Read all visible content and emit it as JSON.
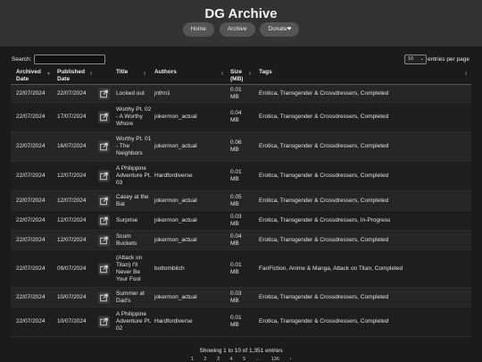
{
  "header": {
    "title": "DG Archive",
    "nav": [
      "Home",
      "Archive",
      "Donate"
    ]
  },
  "controls": {
    "search_label": "Search:",
    "search_value": "",
    "page_length": "10",
    "page_length_label": "entries per page"
  },
  "table": {
    "columns": [
      "Archived Date",
      "Published Date",
      "",
      "Title",
      "Authors",
      "Size (MB)",
      "Tags"
    ],
    "rows": [
      {
        "archived": "22/07/2024",
        "published": "22/07/2024",
        "title": "Locked out",
        "author": "jnthn1",
        "size": "0.01 MB",
        "tags": "Erotica, Transgender & Crossdressers, Completed"
      },
      {
        "archived": "22/07/2024",
        "published": "17/07/2024",
        "title": "Worthy Pt. 02 - A Worthy Whore",
        "author": "jokermon_actual",
        "size": "0.04 MB",
        "tags": "Erotica, Transgender & Crossdressers, Completed"
      },
      {
        "archived": "22/07/2024",
        "published": "16/07/2024",
        "title": "Worthy Pt. 01 - The Neighbors",
        "author": "jokermon_actual",
        "size": "0.06 MB",
        "tags": "Erotica, Transgender & Crossdressers, Completed"
      },
      {
        "archived": "22/07/2024",
        "published": "12/07/2024",
        "title": "A Philippine Adventure Pt. 03",
        "author": "Hardfordiverse",
        "size": "0.01 MB",
        "tags": "Erotica, Transgender & Crossdressers, Completed"
      },
      {
        "archived": "22/07/2024",
        "published": "12/07/2024",
        "title": "Casey at the Bat",
        "author": "jokermon_actual",
        "size": "0.05 MB",
        "tags": "Erotica, Transgender & Crossdressers, Completed"
      },
      {
        "archived": "22/07/2024",
        "published": "12/07/2024",
        "title": "Surprise",
        "author": "jokermon_actual",
        "size": "0.03 MB",
        "tags": "Erotica, Transgender & Crossdressers, In-Progress"
      },
      {
        "archived": "22/07/2024",
        "published": "12/07/2024",
        "title": "Scum Buckets",
        "author": "jokermon_actual",
        "size": "0.04 MB",
        "tags": "Erotica, Transgender & Crossdressers, Completed"
      },
      {
        "archived": "22/07/2024",
        "published": "09/07/2024",
        "title": "(Attack on Titan) I'll Never Be Your Fool",
        "author": "bottombitch",
        "size": "0.01 MB",
        "tags": "FanFiction, Anime & Manga, Attack on Titan, Completed"
      },
      {
        "archived": "22/07/2024",
        "published": "10/07/2024",
        "title": "Summer at Dad's",
        "author": "jokermon_actual",
        "size": "0.03 MB",
        "tags": "Erotica, Transgender & Crossdressers, Completed"
      },
      {
        "archived": "22/07/2024",
        "published": "10/07/2024",
        "title": "A Philippine Adventure Pt. 02",
        "author": "Hardfordiverse",
        "size": "0.01 MB",
        "tags": "Erotica, Transgender & Crossdressers, Completed"
      }
    ]
  },
  "footer": {
    "info": "Showing 1 to 10 of 1,351 entries",
    "pages": [
      "1",
      "2",
      "3",
      "4",
      "5",
      "…",
      "136",
      "›"
    ]
  }
}
